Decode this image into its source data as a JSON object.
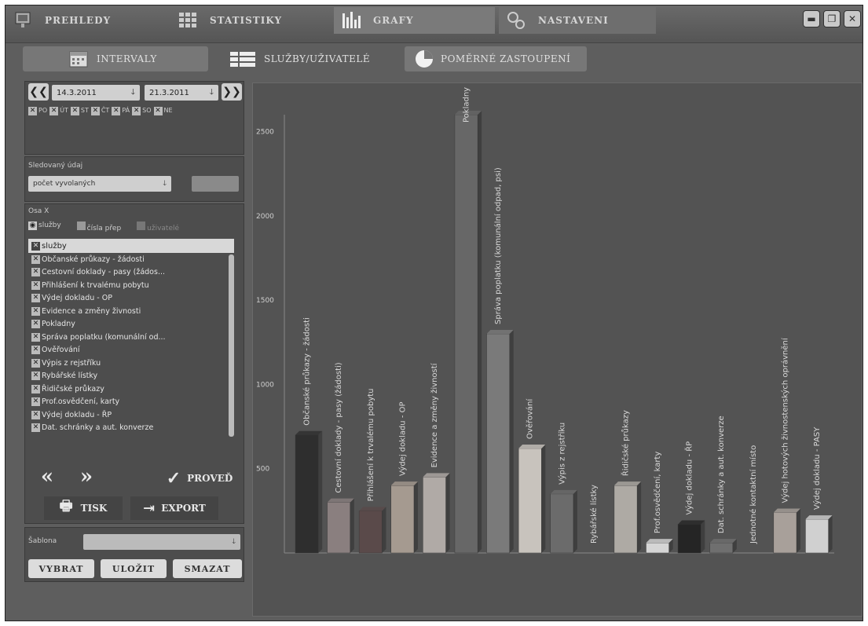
{
  "nav": {
    "tabs": [
      {
        "label": "PREHLEDY",
        "icon": "overview-icon"
      },
      {
        "label": "STATISTIKY",
        "icon": "grid-icon"
      },
      {
        "label": "GRAFY",
        "icon": "bar-chart-icon"
      },
      {
        "label": "NASTAVENI",
        "icon": "settings-icon"
      }
    ]
  },
  "subtabs": [
    {
      "label": "INTERVALY",
      "icon": "calendar-icon"
    },
    {
      "label": "SLUŽBY/UŽIVATELÉ",
      "icon": "list-icon"
    },
    {
      "label": "POMĚRNÉ ZASTOUPENÍ",
      "icon": "pie-chart-icon"
    }
  ],
  "dates": {
    "from": "14.3.2011",
    "to": "21.3.2011"
  },
  "days": [
    "PO",
    "ÚT",
    "ST",
    "ČT",
    "PÁ",
    "SO",
    "NE"
  ],
  "metric": {
    "label": "Sledovaný údaj",
    "value": "počet vyvolaných"
  },
  "axis": {
    "label": "Osa X",
    "options": [
      "služby",
      "čísla přep",
      "uživatelé"
    ],
    "list_header": "služby",
    "items": [
      "Občanské průkazy - žádosti",
      "Cestovní doklady - pasy (žádos...",
      "Přihlášení k trvalému pobytu",
      "Výdej dokladu - OP",
      "Evidence a změny živnosti",
      "Pokladny",
      "Správa poplatku (komunální od...",
      "Ověřování",
      "Výpis z rejstříku",
      "Rybářské lístky",
      "Řidičské průkazy",
      "Prof.osvědčení, karty",
      "Výdej dokladu - ŘP",
      "Dat. schránky a aut. konverze"
    ]
  },
  "buttons": {
    "execute": "PROVEĎ",
    "print": "TISK",
    "export": "EXPORT",
    "select": "VYBRAT",
    "save": "ULOŽIT",
    "delete": "SMAZAT"
  },
  "template": {
    "label": "Šablona"
  },
  "chart_data": {
    "type": "bar",
    "ylim": [
      0,
      2600
    ],
    "yticks": [
      500,
      1000,
      1500,
      2000,
      2500
    ],
    "categories": [
      "Občanské průkazy - žádosti",
      "Cestovní doklady - pasy (žádosti)",
      "Přihlášení k trvalému pobytu",
      "Výdej dokladu - OP",
      "Evidence a změny živností",
      "Pokladny",
      "Správa poplatku (komunální odpad, psi)",
      "Ověřování",
      "Výpis z rejstříku",
      "Rybářské lístky",
      "Řidičské průkazy",
      "Prof.osvědčení, karty",
      "Výdej dokladu - ŘP",
      "Dat. schránky a aut. konverze",
      "Jednotné kontaktní místo",
      "Výdej hotových živnostenských oprávnění",
      "Výdej dokladu - PASY"
    ],
    "values": [
      700,
      300,
      250,
      400,
      450,
      2800,
      1300,
      620,
      350,
      0,
      400,
      60,
      170,
      60,
      0,
      240,
      200
    ],
    "colors": [
      "#2e2e2e",
      "#8a7f7f",
      "#5a4a4a",
      "#a59a90",
      "#b0aaa6",
      "#676767",
      "#7a7a7a",
      "#c8c3bd",
      "#6b6b6b",
      "#666666",
      "#aeaaa4",
      "#d5d5d5",
      "#252525",
      "#6f6f6f",
      "#666666",
      "#a8a09a",
      "#d0d0d0"
    ]
  }
}
